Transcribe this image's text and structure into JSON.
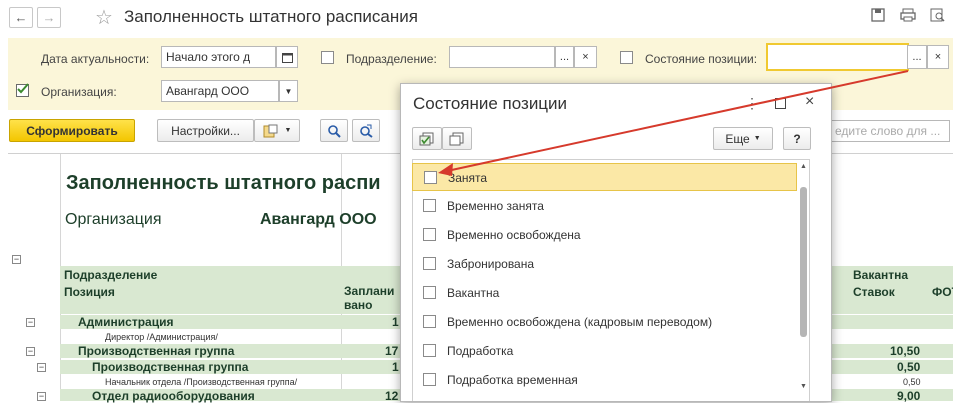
{
  "window": {
    "title": "Заполненность штатного расписания",
    "back": "←",
    "forward": "→",
    "star": "☆"
  },
  "params": {
    "date_label": "Дата актуальности:",
    "date_value": "Начало этого д",
    "division_label": "Подразделение:",
    "division_value": "",
    "state_label": "Состояние позиции:",
    "state_value": "",
    "org_label": "Организация:",
    "org_value": "Авангард ООО",
    "ellipsis": "...",
    "clear": "×"
  },
  "toolbar": {
    "generate": "Сформировать",
    "settings": "Настройки...",
    "search_placeholder": "едите слово для ..."
  },
  "report": {
    "title": "Заполненность штатного распи",
    "org_label": "Организация",
    "org_value": "Авангард ООО",
    "col_division": "Подразделение",
    "col_position": "Позиция",
    "col_planned": "Заплани\nвано",
    "col_vacant": "Вакантна",
    "col_rates": "Ставок",
    "col_fot": "ФОТ",
    "rows": [
      {
        "name": "Администрация",
        "planned": "1",
        "rates": ""
      },
      {
        "name": "Директор /Администрация/",
        "planned": "",
        "rates": ""
      },
      {
        "name": "Производственная группа",
        "planned": "17",
        "rates": "10,50"
      },
      {
        "name": "Производственная группа",
        "planned": "1",
        "rates": "0,50"
      },
      {
        "name": "Начальник отдела /Производственная группа/",
        "planned": "",
        "rates": "0,50"
      },
      {
        "name": "Отдел радиооборудования",
        "planned": "12",
        "rates": "9,00"
      }
    ]
  },
  "popup": {
    "title": "Состояние позиции",
    "more": "Еще",
    "help": "?",
    "items": [
      "Занята",
      "Временно занята",
      "Временно освобождена",
      "Забронирована",
      "Вакантна",
      "Временно освобождена (кадровым переводом)",
      "Подработка",
      "Подработка временная"
    ]
  }
}
